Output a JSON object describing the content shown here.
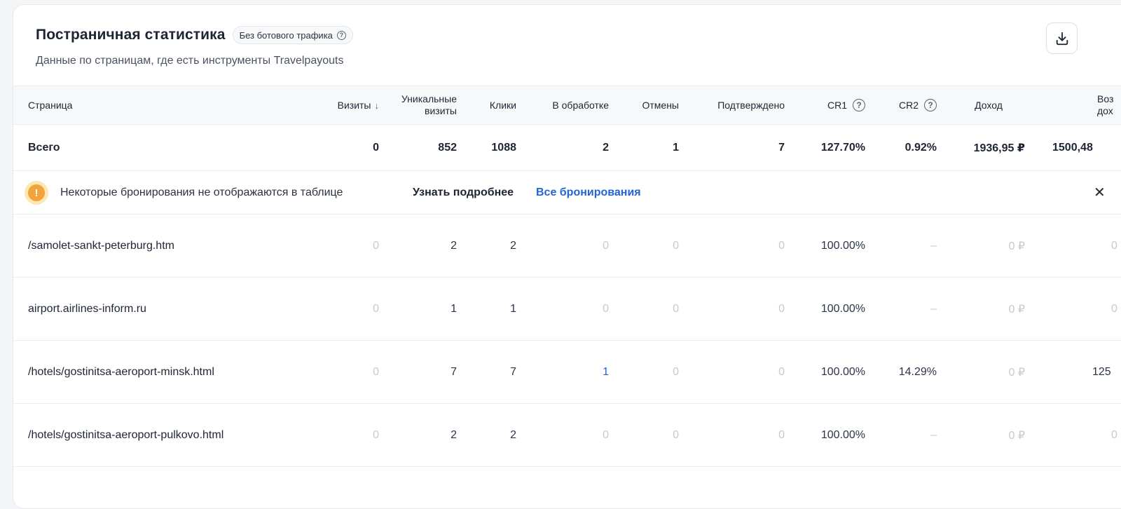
{
  "header": {
    "title": "Постраничная статистика",
    "badge": "Без ботового трафика",
    "subtitle": "Данные по страницам, где есть инструменты Travelpayouts"
  },
  "columns": {
    "page": "Страница",
    "visits": "Визиты",
    "unique_line1": "Уникальные",
    "unique_line2": "визиты",
    "clicks": "Клики",
    "processing": "В обработке",
    "cancelled": "Отмены",
    "confirmed": "Подтверждено",
    "cr1": "CR1",
    "cr2": "CR2",
    "income": "Доход",
    "returned_line1": "Воз",
    "returned_line2": "дох"
  },
  "sort_icon": "arrow-down-icon",
  "total": {
    "label": "Всего",
    "visits": "0",
    "unique": "852",
    "clicks": "1088",
    "processing": "2",
    "cancelled": "1",
    "confirmed": "7",
    "cr1": "127.70%",
    "cr2": "0.92%",
    "income": "1936,95 ₽",
    "returned": "1500,48"
  },
  "notice": {
    "icon": "warning-icon",
    "text": "Некоторые бронирования не отображаются в таблице",
    "more_link": "Узнать подробнее",
    "all_link": "Все бронирования",
    "close": "✕"
  },
  "rows": [
    {
      "page": "/samolet-sankt-peterburg.htm",
      "visits": "0",
      "unique": "2",
      "clicks": "2",
      "processing": "0",
      "cancelled": "0",
      "confirmed": "0",
      "cr1": "100.00%",
      "cr2": "–",
      "income": "0 ₽",
      "returned": "0"
    },
    {
      "page": "airport.airlines-inform.ru",
      "visits": "0",
      "unique": "1",
      "clicks": "1",
      "processing": "0",
      "cancelled": "0",
      "confirmed": "0",
      "cr1": "100.00%",
      "cr2": "–",
      "income": "0 ₽",
      "returned": "0"
    },
    {
      "page": "/hotels/gostinitsa-aeroport-minsk.html",
      "visits": "0",
      "unique": "7",
      "clicks": "7",
      "processing": "1",
      "cancelled": "0",
      "confirmed": "0",
      "cr1": "100.00%",
      "cr2": "14.29%",
      "income": "0 ₽",
      "returned": "125"
    },
    {
      "page": "/hotels/gostinitsa-aeroport-pulkovo.html",
      "visits": "0",
      "unique": "2",
      "clicks": "2",
      "processing": "0",
      "cancelled": "0",
      "confirmed": "0",
      "cr1": "100.00%",
      "cr2": "–",
      "income": "0 ₽",
      "returned": "0"
    }
  ],
  "colors": {
    "link": "#2264d1",
    "muted": "#c5c9d0",
    "warning": "#f2a43a"
  }
}
